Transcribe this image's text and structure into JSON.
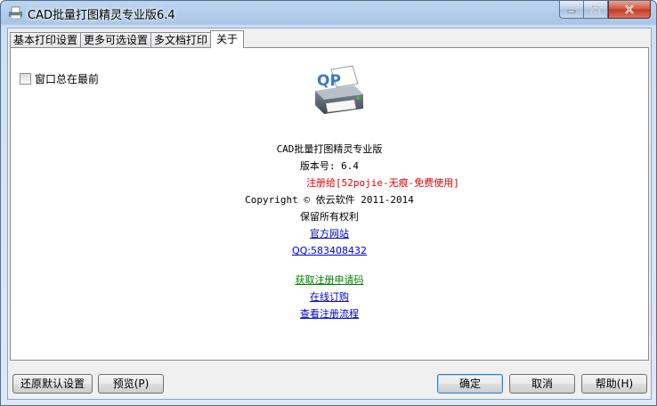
{
  "window": {
    "title": "CAD批量打图精灵专业版6.4"
  },
  "tabs": [
    {
      "label": "基本打印设置"
    },
    {
      "label": "更多可选设置"
    },
    {
      "label": "多文档打印"
    },
    {
      "label": "关于"
    }
  ],
  "about": {
    "always_on_top_label": "窗口总在最前",
    "logo_text": "QP",
    "product_name": "CAD批量打图精灵专业版",
    "version": "版本号: 6.4",
    "registered_to": "注册给[52pojie-无痕-免费使用]",
    "copyright": "Copyright © 依云软件 2011-2014",
    "rights": "保留所有权利",
    "official_site_link": "官方网站",
    "qq_link": "QQ:583408432",
    "get_code_link": "获取注册申请码",
    "order_online_link": "在线订购",
    "view_process_link": "查看注册流程"
  },
  "buttons": {
    "restore_defaults": "还原默认设置",
    "preview": "预览(P)",
    "ok": "确定",
    "cancel": "取消",
    "help": "帮助(H)"
  },
  "colors": {
    "link": "#0000cc",
    "link_green": "#008000",
    "registered": "#e00000"
  }
}
